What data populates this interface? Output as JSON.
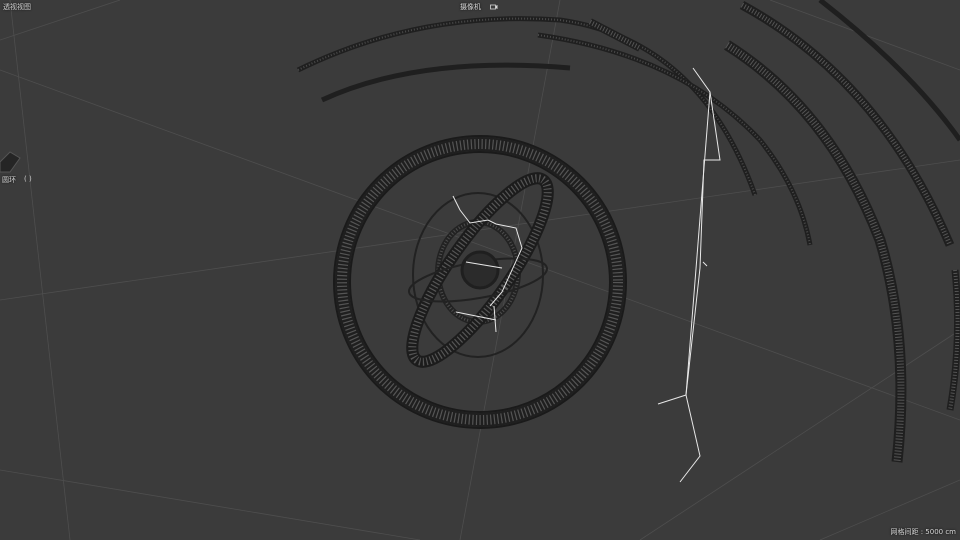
{
  "viewport": {
    "title": "透视视图",
    "camera_label": "摄像机",
    "camera_icon": "camera-icon",
    "selected_object_label": "圆环",
    "selected_object_icon": "target-bracket-icon",
    "grid_spacing_text": "网格间距 : 5000 cm"
  },
  "colors": {
    "background": "#3b3b3b",
    "grid": "#505050",
    "wireframe": "#1f1f1f",
    "wireframe_light": "#5a5a5a",
    "spline": "#e8e8e8",
    "hud_text": "#d8d8d8"
  }
}
